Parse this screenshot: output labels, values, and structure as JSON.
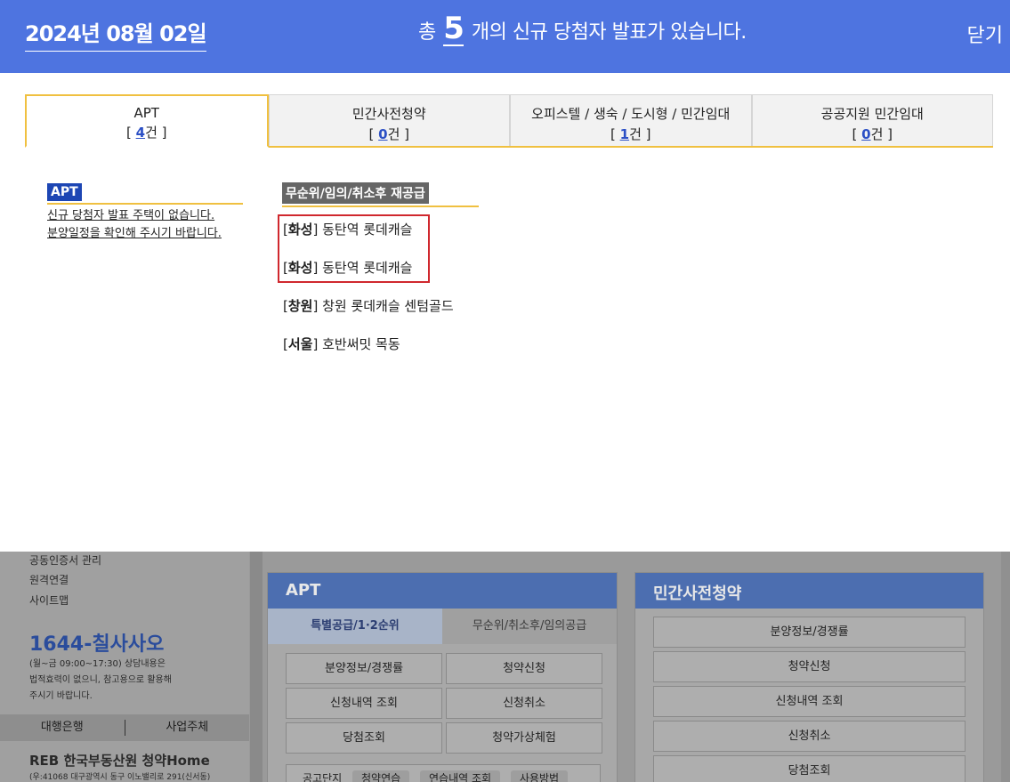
{
  "header": {
    "date": "2024년 08월 02일",
    "message_prefix": "총",
    "count": "5",
    "message_suffix": "개의 신규 당첨자 발표가 있습니다.",
    "close_label": "닫기"
  },
  "tabs": [
    {
      "title": "APT",
      "count": "4",
      "count_suffix": "건",
      "active": true
    },
    {
      "title": "민간사전청약",
      "count": "0",
      "count_suffix": "건",
      "active": false
    },
    {
      "title": "오피스텔 / 생숙 / 도시형 / 민간임대",
      "count": "1",
      "count_suffix": "건",
      "active": false
    },
    {
      "title": "공공지원 민간임대",
      "count": "0",
      "count_suffix": "건",
      "active": false
    }
  ],
  "left_section": {
    "label": "APT",
    "note_line1": "신규 당첨자 발표 주택이 없습니다.",
    "note_line2": "분양일정을 확인해 주시기 바랍니다."
  },
  "right_section": {
    "label": "무순위/임의/취소후 재공급",
    "items": [
      {
        "region": "화성",
        "name": "동탄역 롯데캐슬"
      },
      {
        "region": "화성",
        "name": "동탄역 롯데캐슬"
      },
      {
        "region": "창원",
        "name": "창원 롯데캐슬 센텀골드"
      },
      {
        "region": "서울",
        "name": "호반써밋 목동"
      }
    ]
  },
  "background_page": {
    "sidebar_links": [
      "공동인증서 관리",
      "원격연결",
      "사이트맵"
    ],
    "phone": "1644-칠사사오",
    "hours_line1": "(월~금 09:00~17:30) 상담내용은",
    "hours_line2": "법적효력이 없으니, 참고용으로 활용해",
    "hours_line3": "주시기 바랍니다.",
    "agent_bar": [
      "대행은행",
      "사업주체"
    ],
    "logo_text": "REB 한국부동산원 청약Home",
    "address": "(우:41068 대구광역시 동구 이노밸리로 291(신서동)",
    "apt_card": {
      "title": "APT",
      "tab_on": "특별공급/1·2순위",
      "tab_off": "무순위/취소후/임의공급",
      "buttons": [
        "분양정보/경쟁률",
        "청약신청",
        "신청내역 조회",
        "신청취소",
        "당첨조회",
        "청약가상체험"
      ],
      "notice_label": "공고단지",
      "notice_pills": [
        "청약연습",
        "연습내역 조회",
        "사용방법"
      ]
    },
    "pre_card": {
      "title": "민간사전청약",
      "buttons": [
        "분양정보/경쟁률",
        "청약신청",
        "신청내역 조회",
        "신청취소",
        "당첨조회"
      ]
    }
  }
}
